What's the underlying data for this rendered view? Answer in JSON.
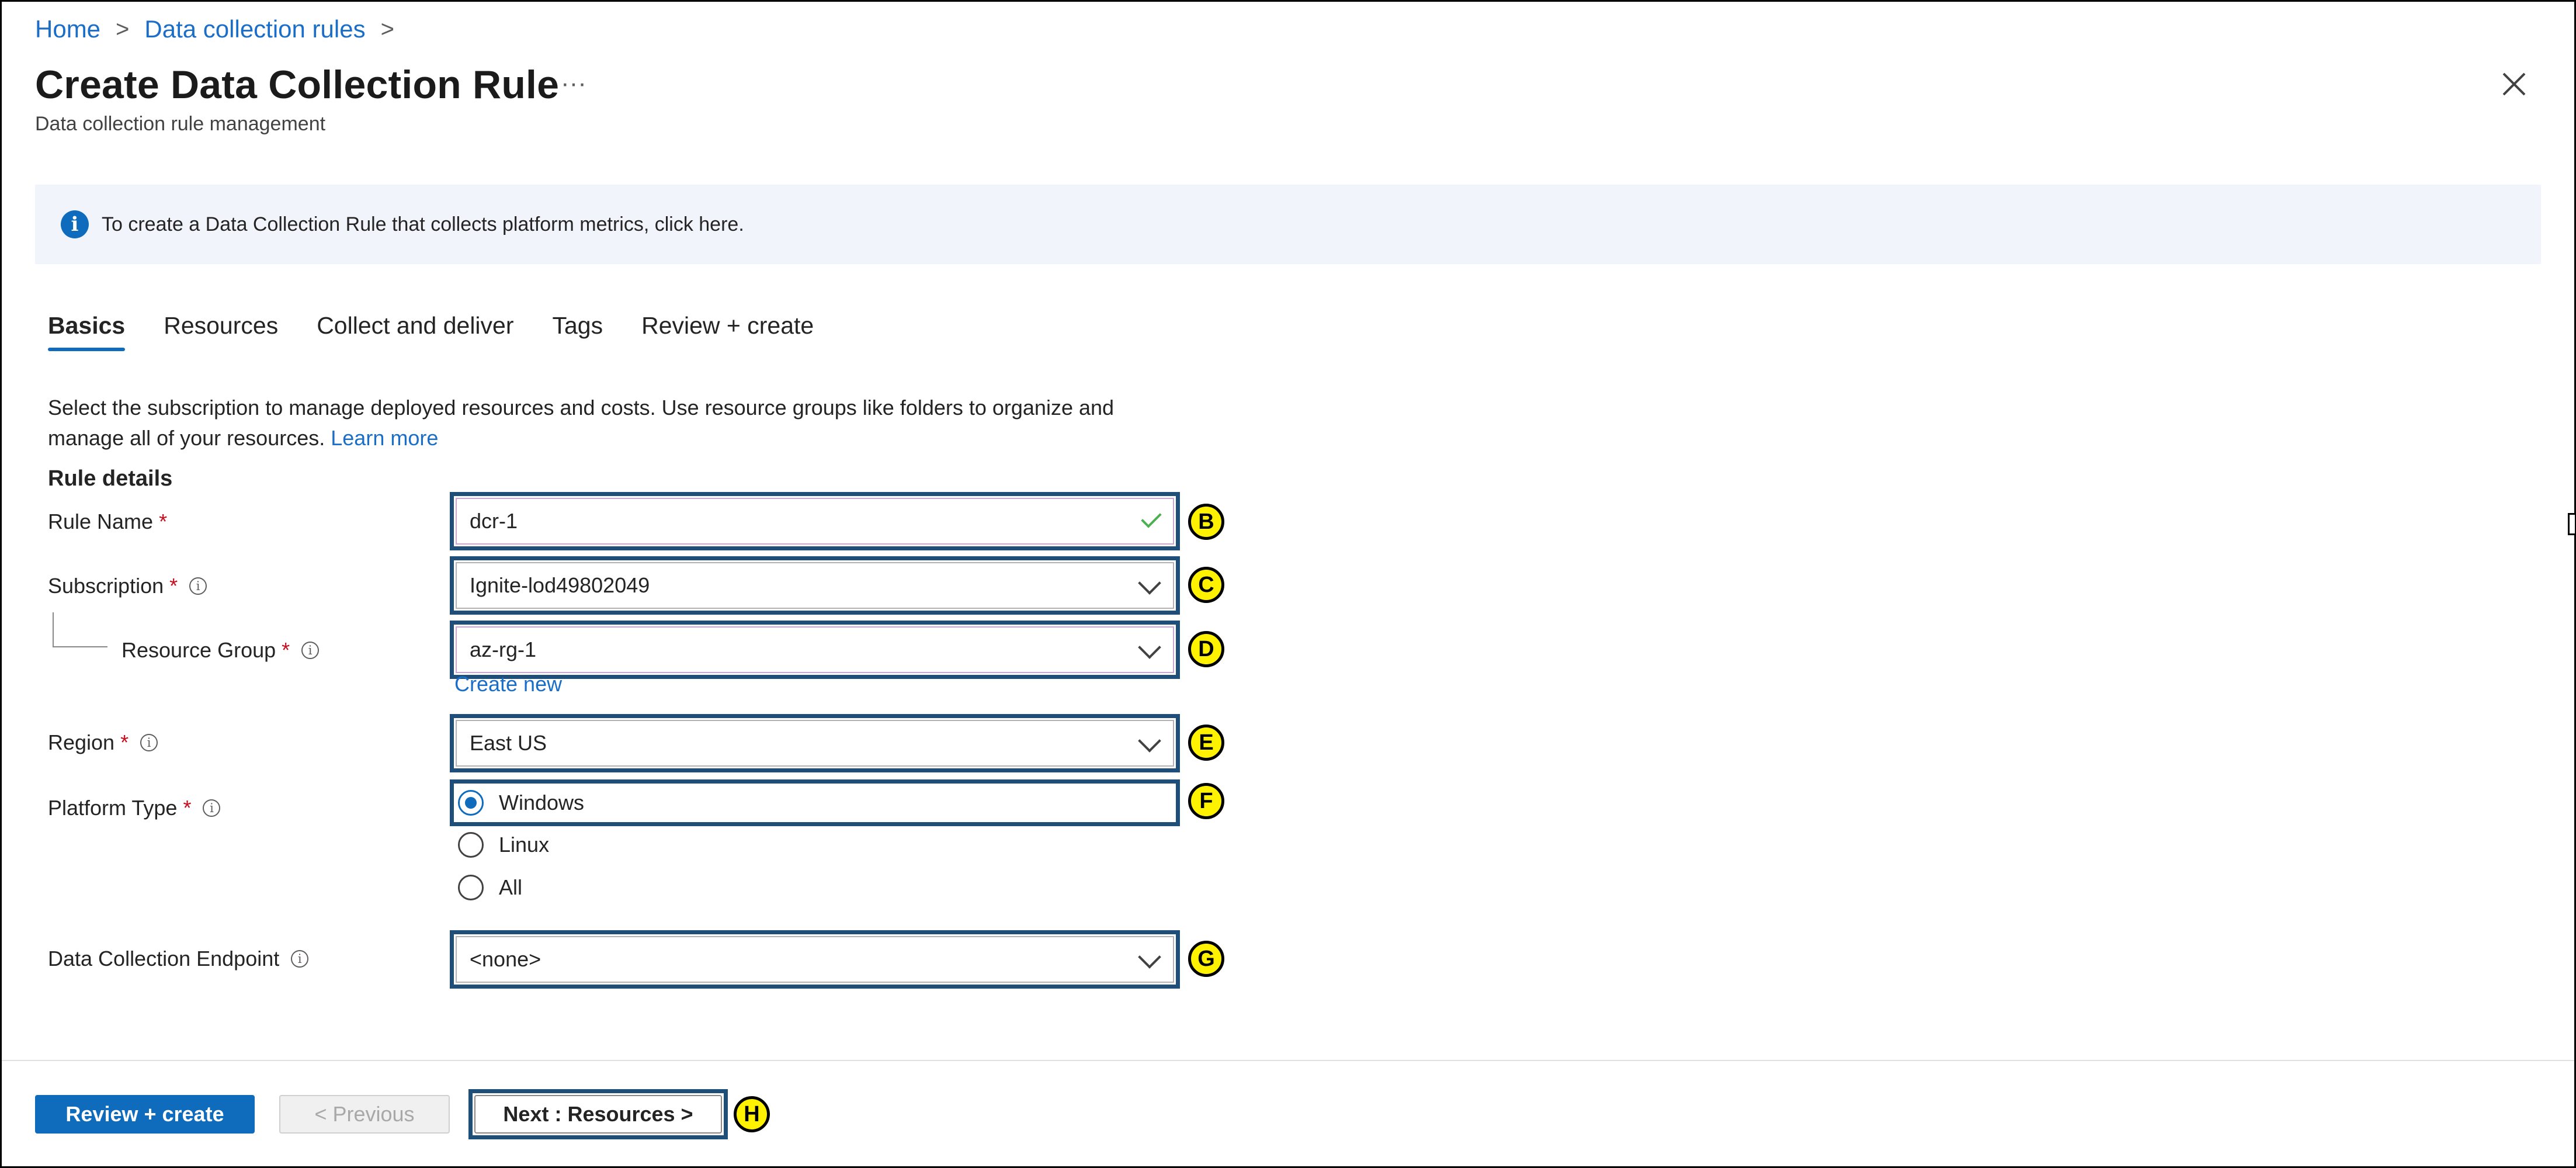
{
  "breadcrumb": {
    "home": "Home",
    "rules": "Data collection rules"
  },
  "header": {
    "title": "Create Data Collection Rule",
    "more": "···",
    "subtitle": "Data collection rule management"
  },
  "banner": {
    "text": "To create a Data Collection Rule that collects platform metrics, click here."
  },
  "tabs": [
    {
      "label": "Basics"
    },
    {
      "label": "Resources"
    },
    {
      "label": "Collect and deliver"
    },
    {
      "label": "Tags"
    },
    {
      "label": "Review + create"
    }
  ],
  "description": {
    "text": "Select the subscription to manage deployed resources and costs. Use resource groups like folders to organize and manage all of your resources.",
    "learn_more": "Learn more"
  },
  "section_title": "Rule details",
  "form": {
    "rule_name": {
      "label": "Rule Name",
      "value": "dcr-1"
    },
    "subscription": {
      "label": "Subscription",
      "value": "Ignite-lod49802049"
    },
    "resource_group": {
      "label": "Resource Group",
      "value": "az-rg-1",
      "create_new": "Create new"
    },
    "region": {
      "label": "Region",
      "value": "East US"
    },
    "platform_type": {
      "label": "Platform Type",
      "options": [
        "Windows",
        "Linux",
        "All"
      ],
      "selected": "Windows"
    },
    "endpoint": {
      "label": "Data Collection Endpoint",
      "value": "<none>"
    }
  },
  "markers": {
    "b": "B",
    "c": "C",
    "d": "D",
    "e": "E",
    "f": "F",
    "g": "G",
    "h": "H"
  },
  "footer": {
    "review_create": "Review + create",
    "previous": "< Previous",
    "next": "Next : Resources >"
  },
  "colors": {
    "accent": "#0f6cbd",
    "link": "#1a6ec7",
    "highlight": "#1f4e79",
    "marker": "#fff200",
    "required": "#c50f1f"
  }
}
